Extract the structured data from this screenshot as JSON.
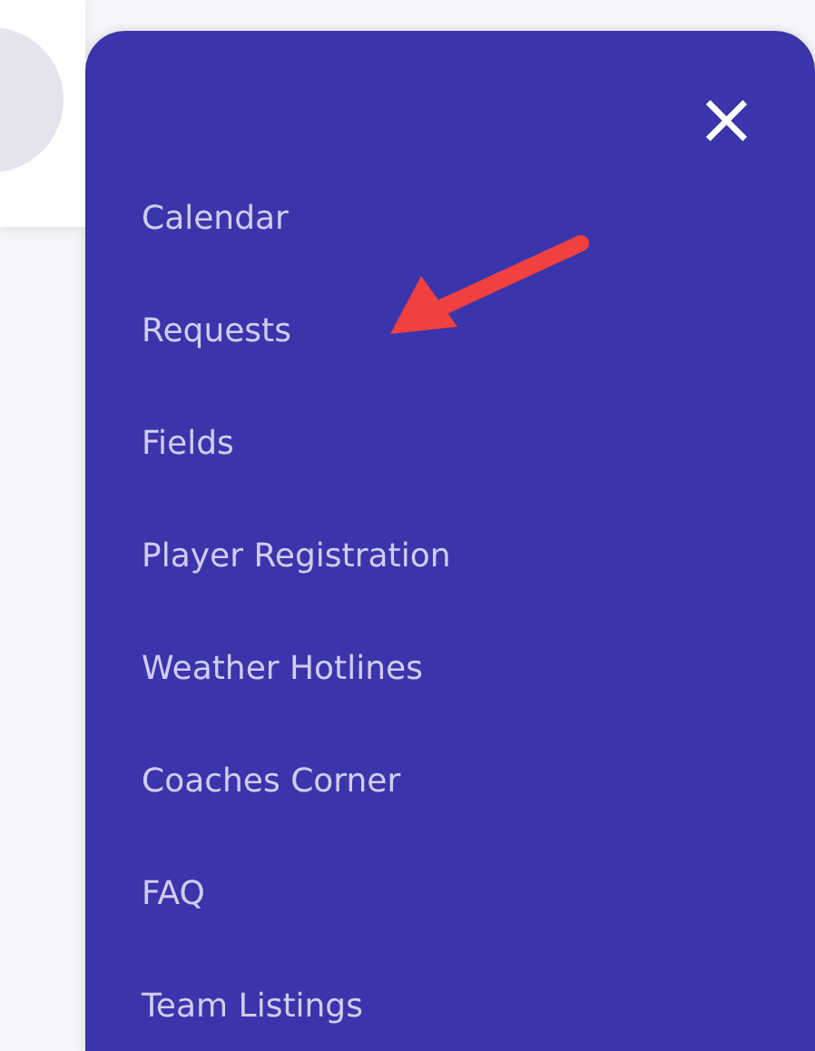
{
  "menu": {
    "close_icon": "×",
    "items": [
      {
        "label": "Calendar"
      },
      {
        "label": "Requests"
      },
      {
        "label": "Fields"
      },
      {
        "label": "Player Registration"
      },
      {
        "label": "Weather Hotlines"
      },
      {
        "label": "Coaches Corner"
      },
      {
        "label": "FAQ"
      },
      {
        "label": "Team Listings"
      }
    ]
  }
}
